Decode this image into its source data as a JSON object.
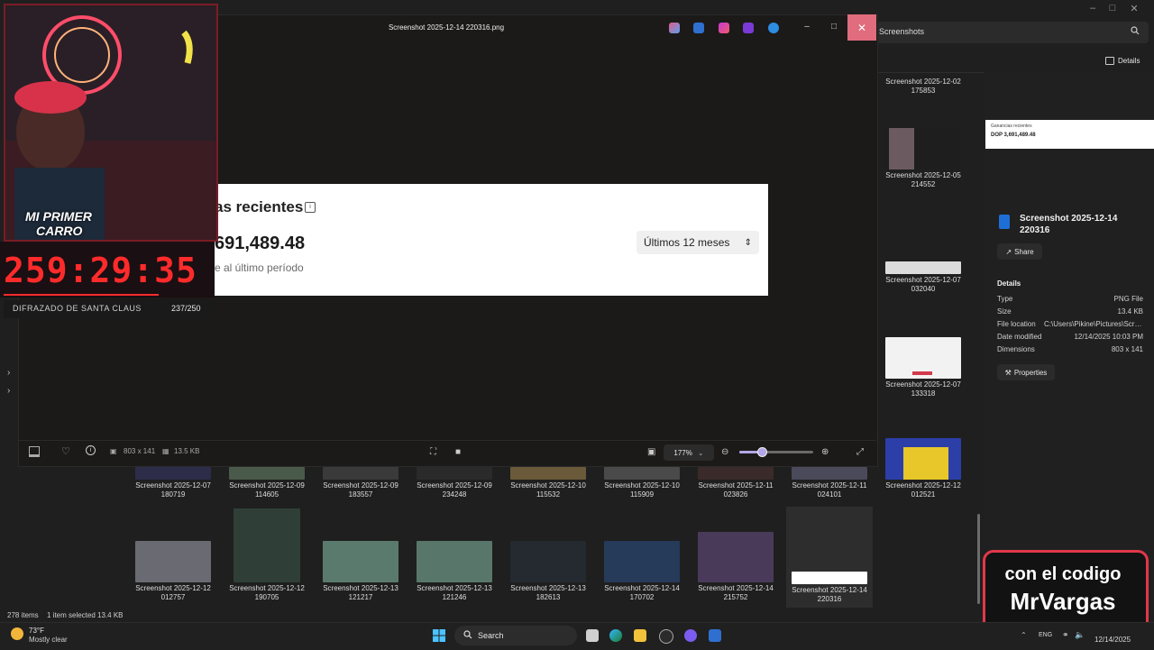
{
  "explorer": {
    "search_text": "Screenshots",
    "details_label": "Details",
    "side_thumbs": [
      {
        "caption1": "Screenshot 2025-12-02",
        "caption2": "175853"
      },
      {
        "caption1": "Screenshot 2025-12-05",
        "caption2": "214552"
      },
      {
        "caption1": "Screenshot 2025-12-07",
        "caption2": "032040"
      },
      {
        "caption1": "Screenshot 2025-12-07",
        "caption2": "133318"
      },
      {
        "caption1": "Screenshot 2025-12-12",
        "caption2": "012521"
      }
    ],
    "row1": [
      {
        "caption1": "Screenshot 2025-12-07",
        "caption2": "180719"
      },
      {
        "caption1": "Screenshot 2025-12-09",
        "caption2": "114605"
      },
      {
        "caption1": "Screenshot 2025-12-09",
        "caption2": "183557"
      },
      {
        "caption1": "Screenshot 2025-12-09",
        "caption2": "234248"
      },
      {
        "caption1": "Screenshot 2025-12-10",
        "caption2": "115532"
      },
      {
        "caption1": "Screenshot 2025-12-10",
        "caption2": "115909"
      },
      {
        "caption1": "Screenshot 2025-12-11",
        "caption2": "023826"
      },
      {
        "caption1": "Screenshot 2025-12-11",
        "caption2": "024101"
      }
    ],
    "row2": [
      {
        "caption1": "Screenshot 2025-12-12",
        "caption2": "012757"
      },
      {
        "caption1": "Screenshot 2025-12-12",
        "caption2": "190705"
      },
      {
        "caption1": "Screenshot 2025-12-13",
        "caption2": "121217"
      },
      {
        "caption1": "Screenshot 2025-12-13",
        "caption2": "121246"
      },
      {
        "caption1": "Screenshot 2025-12-13",
        "caption2": "182613"
      },
      {
        "caption1": "Screenshot 2025-12-14",
        "caption2": "170702"
      },
      {
        "caption1": "Screenshot 2025-12-14",
        "caption2": "215752"
      },
      {
        "caption1": "Screenshot 2025-12-14",
        "caption2": "220316"
      }
    ],
    "status_items": "278 items",
    "status_selected": "1 item selected  13.4 KB"
  },
  "details_pane": {
    "preview_title": "Ganancias recientes",
    "preview_amount": "DOP 3,691,489.48",
    "file_name": "Screenshot 2025-12-14 220316",
    "share_label": "Share",
    "details_heading": "Details",
    "rows": [
      {
        "label": "Type",
        "value": "PNG File"
      },
      {
        "label": "Size",
        "value": "13.4 KB"
      },
      {
        "label": "File location",
        "value": "C:\\Users\\Pikine\\Pictures\\Scre..."
      },
      {
        "label": "Date modified",
        "value": "12/14/2025 10:03 PM"
      },
      {
        "label": "Dimensions",
        "value": "803 x 141"
      }
    ],
    "properties_label": "Properties"
  },
  "photos": {
    "title": "Screenshot 2025-12-14 220316.png",
    "image": {
      "heading": "as recientes",
      "amount": "691,489.48",
      "subtext": "e al último período",
      "dropdown": "Últimos 12 meses"
    },
    "bottom": {
      "dimensions": "803 x 141",
      "size": "13.5 KB",
      "zoom": "177%",
      "zoom_level": 0.3
    }
  },
  "overlay": {
    "cam_banner_1": "MI PRIMER",
    "cam_banner_2": "CARRO",
    "timer": "259:29:35",
    "goal_label": "DIFRAZADO DE SANTA CLAUS",
    "goal_count": "237/250",
    "goal_progress": 0.948,
    "promo_line1": "con el codigo",
    "promo_line2": "MrVargas"
  },
  "taskbar": {
    "weather_temp": "73°F",
    "weather_desc": "Mostly clear",
    "search_label": "Search",
    "lang": "ENG",
    "date": "12/14/2025"
  },
  "colors": {
    "accent_red": "#e0384a",
    "close_hover": "#e06c7d",
    "slider": "#b4a6e8"
  }
}
